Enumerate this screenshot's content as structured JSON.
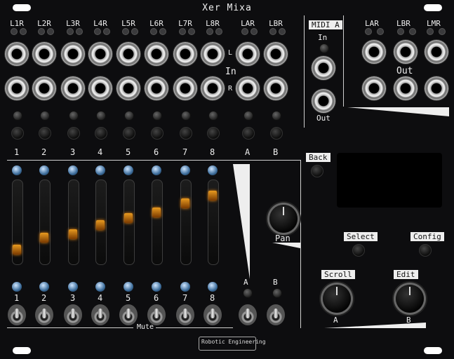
{
  "title": "Xer Mixa",
  "channels": [
    "L1R",
    "L2R",
    "L3R",
    "L4R",
    "L5R",
    "L6R",
    "L7R",
    "L8R",
    "LAR",
    "LBR"
  ],
  "midi": {
    "label": "MIDI A",
    "in": "In",
    "out": "Out"
  },
  "outputs": {
    "labels": [
      "LAR",
      "LBR",
      "LMR"
    ],
    "section": "Out"
  },
  "row_labels": {
    "in": "In",
    "l": "L",
    "r": "R"
  },
  "channel_numbers": [
    "1",
    "2",
    "3",
    "4",
    "5",
    "6",
    "7",
    "8",
    "A",
    "B"
  ],
  "buttons": {
    "back": "Back",
    "select": "Select",
    "config": "Config",
    "scroll": "Scroll",
    "edit": "Edit"
  },
  "pan": "Pan",
  "mute": "Mute",
  "knob_letters": {
    "a": "A",
    "b": "B"
  },
  "bus_labels": [
    "A",
    "B"
  ],
  "fader_levels": [
    0.12,
    0.28,
    0.33,
    0.45,
    0.55,
    0.62,
    0.75,
    0.85
  ],
  "brand": "Robotic Engineering",
  "colors": {
    "panel": "#0d0d0f",
    "text": "#eeeeee",
    "accent": "#f08a10",
    "globe": "#3c6c9a"
  }
}
